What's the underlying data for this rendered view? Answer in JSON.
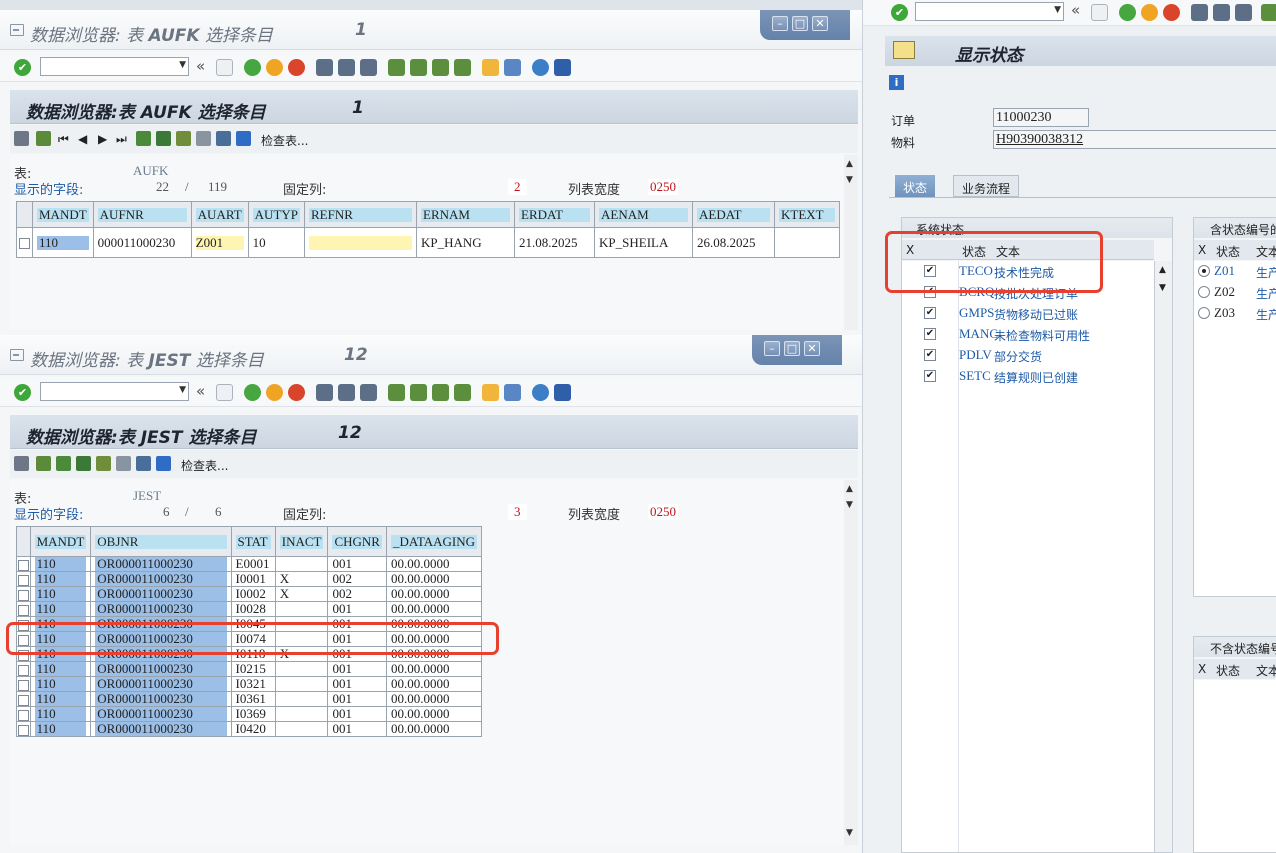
{
  "common": {
    "back_chevron": "«",
    "dropdown_arrow": "▼",
    "check_mark": "✔",
    "check_table_label": "检查表..."
  },
  "aufk_window": {
    "title_prefix": "数据浏览器:",
    "title_table": "表",
    "title_name": "AUFK",
    "title_suffix": "选择条目",
    "count": "1",
    "info": {
      "table_label": "表:",
      "table_value": "AUFK",
      "fields_label": "显示的字段:",
      "fields_shown": "22",
      "fields_sep": "/",
      "fields_total": "119",
      "fixed_cols_label": "固定列:",
      "fixed_cols_value": "2",
      "list_width_label": "列表宽度",
      "list_width_value": "0250"
    },
    "columns": [
      "MANDT",
      "AUFNR",
      "AUART",
      "AUTYP",
      "REFNR",
      "ERNAM",
      "ERDAT",
      "AENAM",
      "AEDAT",
      "KTEXT"
    ],
    "rows": [
      [
        "110",
        "000011000230",
        "Z001",
        "10",
        "",
        "KP_HANG",
        "21.08.2025",
        "KP_SHEILA",
        "26.08.2025",
        ""
      ]
    ]
  },
  "jest_window": {
    "title_prefix": "数据浏览器:",
    "title_table": "表",
    "title_name": "JEST",
    "title_suffix": "选择条目",
    "count": "12",
    "info": {
      "table_label": "表:",
      "table_value": "JEST",
      "fields_label": "显示的字段:",
      "fields_shown": "6",
      "fields_sep": "/",
      "fields_total": "6",
      "fixed_cols_label": "固定列:",
      "fixed_cols_value": "3",
      "list_width_label": "列表宽度",
      "list_width_value": "0250"
    },
    "columns": [
      "MANDT",
      "OBJNR",
      "STAT",
      "INACT",
      "CHGNR",
      "_DATAAGING"
    ],
    "rows": [
      [
        "110",
        "OR000011000230",
        "E0001",
        "",
        "001",
        "00.00.0000"
      ],
      [
        "110",
        "OR000011000230",
        "I0001",
        "X",
        "002",
        "00.00.0000"
      ],
      [
        "110",
        "OR000011000230",
        "I0002",
        "X",
        "002",
        "00.00.0000"
      ],
      [
        "110",
        "OR000011000230",
        "I0028",
        "",
        "001",
        "00.00.0000"
      ],
      [
        "110",
        "OR000011000230",
        "I0045",
        "",
        "001",
        "00.00.0000"
      ],
      [
        "110",
        "OR000011000230",
        "I0074",
        "",
        "001",
        "00.00.0000"
      ],
      [
        "110",
        "OR000011000230",
        "I0118",
        "X",
        "001",
        "00.00.0000"
      ],
      [
        "110",
        "OR000011000230",
        "I0215",
        "",
        "001",
        "00.00.0000"
      ],
      [
        "110",
        "OR000011000230",
        "I0321",
        "",
        "001",
        "00.00.0000"
      ],
      [
        "110",
        "OR000011000230",
        "I0361",
        "",
        "001",
        "00.00.0000"
      ],
      [
        "110",
        "OR000011000230",
        "I0369",
        "",
        "001",
        "00.00.0000"
      ],
      [
        "110",
        "OR000011000230",
        "I0420",
        "",
        "001",
        "00.00.0000"
      ]
    ]
  },
  "status_panel": {
    "title": "显示状态",
    "order_label": "订单",
    "order_value": "11000230",
    "material_label": "物料",
    "material_value": "H90390038312",
    "tabs": [
      "状态",
      "业务流程"
    ],
    "system_status_title": "系统状态",
    "col_x": "X",
    "col_status": "状态",
    "col_text": "文本",
    "system_status": [
      {
        "code": "TECO",
        "text": "技术性完成"
      },
      {
        "code": "BCRQ",
        "text": "按批次处理订单"
      },
      {
        "code": "GMPS",
        "text": "货物移动已过账"
      },
      {
        "code": "MANC",
        "text": "未检查物料可用性"
      },
      {
        "code": "PDLV",
        "text": "部分交货"
      },
      {
        "code": "SETC",
        "text": "结算规则已创建"
      }
    ],
    "with_status_no_title": "含状态编号的",
    "with_status_no": [
      {
        "code": "Z01",
        "text": "生产"
      },
      {
        "code": "Z02",
        "text": "生产"
      },
      {
        "code": "Z03",
        "text": "生产"
      }
    ],
    "without_status_no_title": "不含状态编号"
  },
  "colors": {
    "highlight": "#e8402f",
    "header_blue": "#b9e1f1",
    "selected_blue": "#9bbfe6",
    "link_blue": "#1e5aa6"
  }
}
